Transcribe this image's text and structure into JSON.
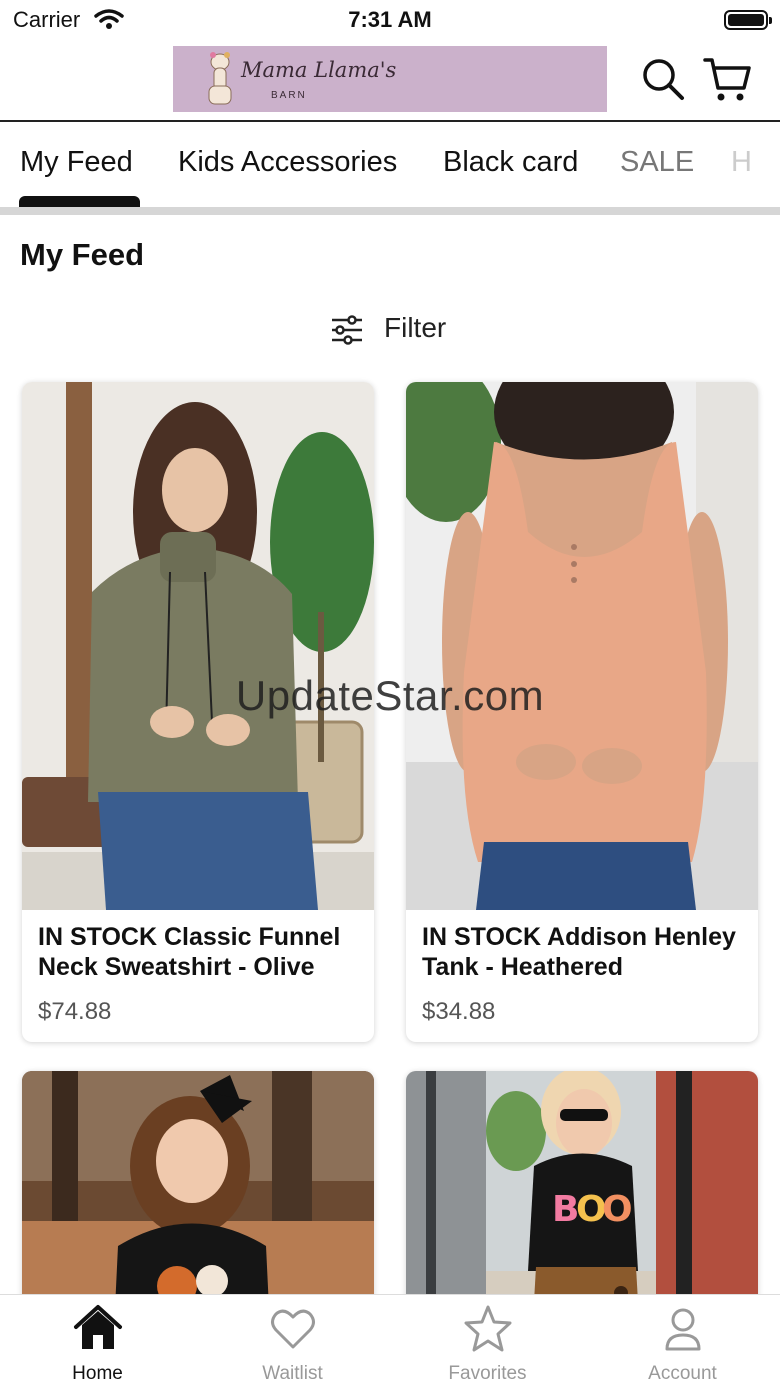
{
  "status_bar": {
    "carrier": "Carrier",
    "time": "7:31 AM"
  },
  "header": {
    "logo_script": "Mama Llama's",
    "logo_sub": "BARN"
  },
  "tabs": [
    {
      "label": "My Feed"
    },
    {
      "label": "Kids Accessories"
    },
    {
      "label": "Black card"
    },
    {
      "label": "SALE"
    },
    {
      "label": "H"
    }
  ],
  "page_title": "My Feed",
  "filter_label": "Filter",
  "watermark": "UpdateStar.com",
  "products": [
    {
      "name": "IN STOCK Classic Funnel Neck Sweatshirt - Olive",
      "price": "$74.88"
    },
    {
      "name": "IN STOCK Addison Henley Tank - Heathered",
      "price": "$34.88"
    },
    {
      "name": "",
      "price": ""
    },
    {
      "name": "",
      "price": ""
    }
  ],
  "bottom_nav": [
    {
      "label": "Home",
      "icon": "home-icon"
    },
    {
      "label": "Waitlist",
      "icon": "heart-icon"
    },
    {
      "label": "Favorites",
      "icon": "star-icon"
    },
    {
      "label": "Account",
      "icon": "person-icon"
    }
  ],
  "colors": {
    "logo_bg": "#cbb1cb",
    "active": "#111111",
    "inactive": "#999999"
  }
}
